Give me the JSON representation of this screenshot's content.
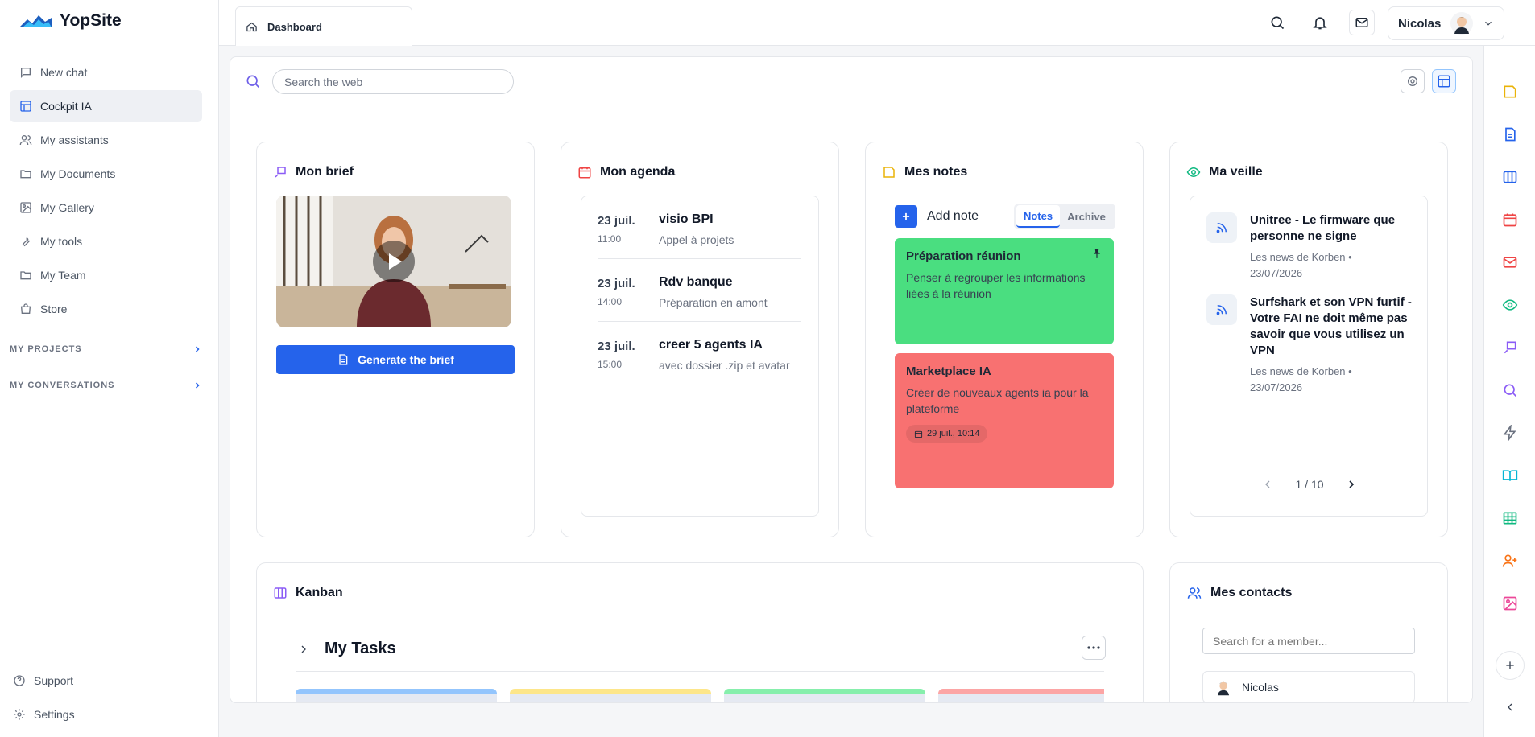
{
  "app": {
    "name": "YopSite"
  },
  "sidebar": {
    "items": [
      {
        "label": "New chat",
        "icon": "chat-icon"
      },
      {
        "label": "Cockpit IA",
        "icon": "layout-icon",
        "active": true
      },
      {
        "label": "My assistants",
        "icon": "users-icon"
      },
      {
        "label": "My Documents",
        "icon": "folder-icon"
      },
      {
        "label": "My Gallery",
        "icon": "image-icon"
      },
      {
        "label": "My tools",
        "icon": "wrench-icon"
      },
      {
        "label": "My Team",
        "icon": "folder-icon"
      },
      {
        "label": "Store",
        "icon": "store-icon"
      }
    ],
    "sections": [
      {
        "label": "MY PROJECTS"
      },
      {
        "label": "MY CONVERSATIONS"
      }
    ],
    "bottom": [
      {
        "label": "Support",
        "icon": "help-icon"
      },
      {
        "label": "Settings",
        "icon": "gear-icon"
      }
    ]
  },
  "topbar": {
    "tab_label": "Dashboard",
    "user_name": "Nicolas"
  },
  "search": {
    "placeholder": "Search the web"
  },
  "brief": {
    "title": "Mon brief",
    "button_label": "Generate the brief"
  },
  "agenda": {
    "title": "Mon agenda",
    "items": [
      {
        "date": "23 juil.",
        "time": "11:00",
        "title": "visio BPI",
        "subtitle": "Appel à projets"
      },
      {
        "date": "23 juil.",
        "time": "14:00",
        "title": "Rdv banque",
        "subtitle": "Préparation en amont"
      },
      {
        "date": "23 juil.",
        "time": "15:00",
        "title": "creer 5 agents IA",
        "subtitle": "avec dossier .zip et avatar"
      }
    ]
  },
  "notes": {
    "title": "Mes notes",
    "add_label": "Add note",
    "tabs": [
      "Notes",
      "Archive"
    ],
    "items": [
      {
        "title": "Préparation réunion",
        "body": "Penser à regrouper les informations liées à la réunion",
        "color": "#4ade80",
        "pinned": true
      },
      {
        "title": "Marketplace IA",
        "body": "Créer de nouveaux agents ia pour la plateforme",
        "color": "#f87171",
        "tag": "29 juil., 10:14"
      }
    ]
  },
  "veille": {
    "title": "Ma veille",
    "items": [
      {
        "title": "Unitree - Le firmware que personne ne signe",
        "source": "Les news de Korben •",
        "date": "23/07/2026"
      },
      {
        "title": "Surfshark et son VPN furtif - Votre FAI ne doit même pas savoir que vous utilisez un VPN",
        "source": "Les news de Korben •",
        "date": "23/07/2026"
      }
    ],
    "pagination": "1 / 10"
  },
  "kanban": {
    "title": "Kanban",
    "board_title": "My Tasks"
  },
  "contacts": {
    "title": "Mes contacts",
    "search_placeholder": "Search for a member...",
    "first_contact": "Nicolas"
  },
  "colors": {
    "primary": "#2563eb",
    "note_green": "#4ade80",
    "note_red": "#f87171"
  }
}
